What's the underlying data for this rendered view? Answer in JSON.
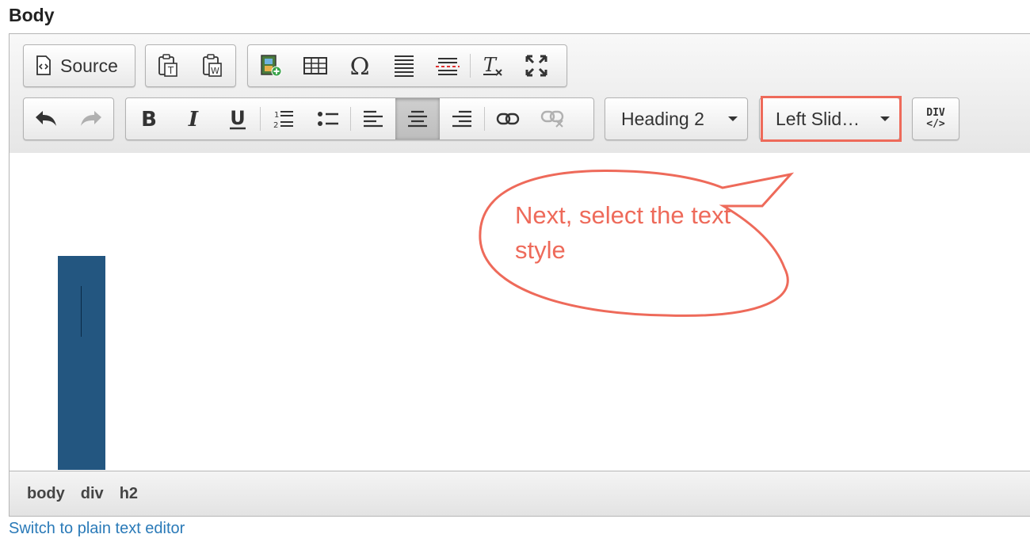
{
  "field": {
    "label": "Body"
  },
  "toolbar": {
    "source_label": "Source",
    "format_select": {
      "value": "Heading 2"
    },
    "styles_select": {
      "value": "Left Slid…"
    },
    "div_label_top": "DIV",
    "div_label_bottom": "</>"
  },
  "icons": {
    "source": "source-icon",
    "paste_text": "paste-text-icon",
    "paste_word": "paste-word-icon",
    "media": "media-embed-icon",
    "table": "table-icon",
    "special_char": "omega-icon",
    "horizontal_rule": "horizontal-rule-icon",
    "page_break": "page-break-icon",
    "remove_format": "remove-format-icon",
    "maximize": "maximize-icon",
    "undo": "undo-icon",
    "redo": "redo-icon",
    "bold": "bold-icon",
    "italic": "italic-icon",
    "underline": "underline-icon",
    "numbered_list": "numbered-list-icon",
    "bulleted_list": "bulleted-list-icon",
    "align_left": "align-left-icon",
    "align_center": "align-center-icon",
    "align_right": "align-right-icon",
    "link": "link-icon",
    "unlink": "unlink-icon"
  },
  "annotation": {
    "text": "Next, select the text style",
    "color": "#ee6a5a"
  },
  "content": {
    "block_color": "#235680"
  },
  "statusbar": {
    "path": [
      "body",
      "div",
      "h2"
    ]
  },
  "footer": {
    "switch_link": "Switch to plain text editor"
  }
}
